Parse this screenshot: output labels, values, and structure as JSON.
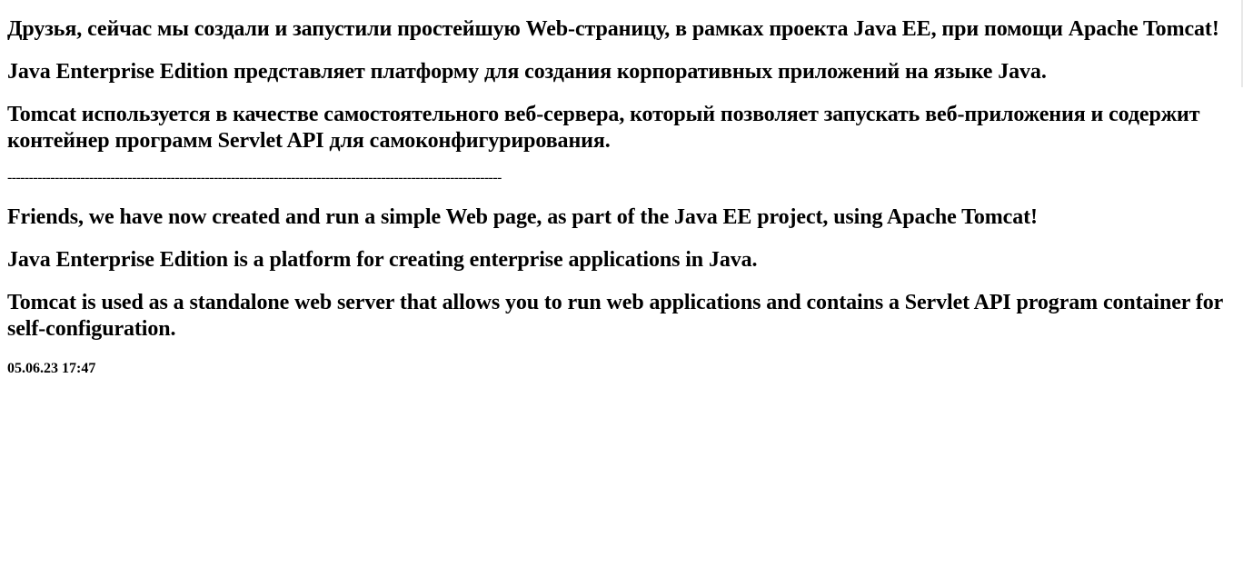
{
  "ru": {
    "p1": "Друзья, сейчас мы создали и запустили простейшую Web-страницу, в рамках проекта Java EE, при помощи Apache Tomcat!",
    "p2": "Java Enterprise Edition представляет платформу для создания корпоративных приложений на языке Java.",
    "p3": "Tomcat используется в качестве самостоятельного веб-сервера, который позволяет запускать веб-приложения и содержит контейнер программ Servlet API для самоконфигурирования."
  },
  "divider": "-------------------------------------------------------------------------------------------------------------------",
  "en": {
    "p1": "Friends, we have now created and run a simple Web page, as part of the Java EE project, using Apache Tomcat!",
    "p2": "Java Enterprise Edition is a platform for creating enterprise applications in Java.",
    "p3": "Tomcat is used as a standalone web server that allows you to run web applications and contains a Servlet API program container for self-configuration."
  },
  "timestamp": "05.06.23 17:47"
}
